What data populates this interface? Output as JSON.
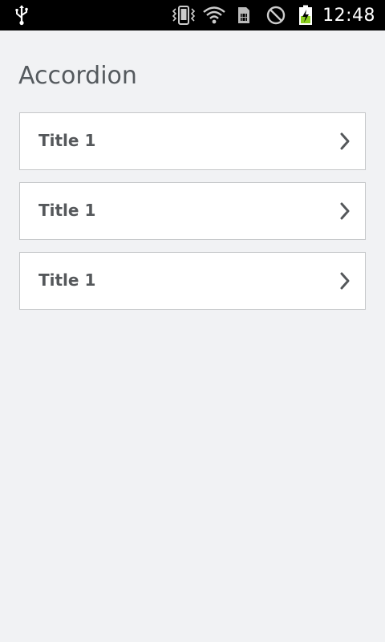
{
  "status_bar": {
    "time": "12:48",
    "icons": [
      "usb-icon",
      "vibrate-icon",
      "wifi-icon",
      "sim-card-icon",
      "no-signal-icon",
      "battery-charging-icon"
    ],
    "battery_color": "#8ccf1f"
  },
  "page": {
    "title": "Accordion"
  },
  "accordion": {
    "items": [
      {
        "label": "Title 1",
        "icon": "chevron-right-icon"
      },
      {
        "label": "Title 1",
        "icon": "chevron-right-icon"
      },
      {
        "label": "Title 1",
        "icon": "chevron-right-icon"
      }
    ]
  },
  "colors": {
    "background": "#f1f2f4",
    "card": "#ffffff",
    "card_border": "#c5c7c9",
    "title_text": "#555a5e",
    "item_text": "#55585b"
  }
}
